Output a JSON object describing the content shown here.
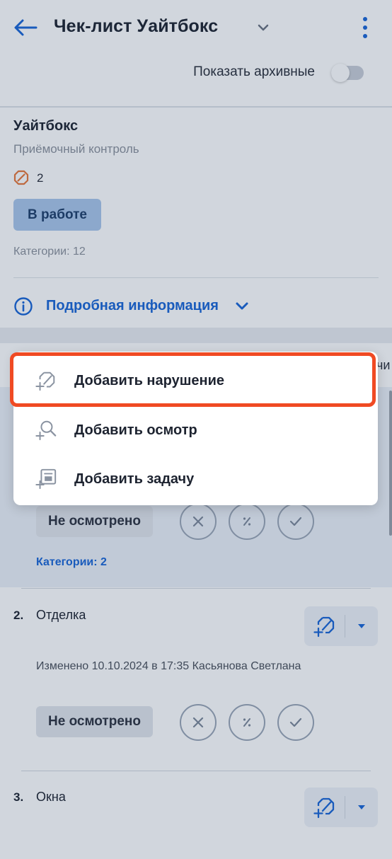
{
  "header": {
    "title": "Чек-лист Уайтбокс",
    "back_icon": "arrow-left-icon",
    "more_icon": "kebab-vertical-icon"
  },
  "archive": {
    "label": "Показать архивные",
    "enabled": false
  },
  "summary": {
    "object_name": "Уайтбокс",
    "control_type": "Приёмочный контроль",
    "violations_count": "2",
    "status": "В работе",
    "categories": "Категории: 12",
    "details_link": "Подробная информация"
  },
  "peek_text": "чи",
  "item1": {
    "status": "Не осмотрено",
    "categories": "Категории: 2"
  },
  "item2": {
    "number": "2.",
    "name": "Отделка",
    "changed": "Изменено 10.10.2024 в 17:35 Касьянова Светлана",
    "status": "Не осмотрено"
  },
  "item3": {
    "number": "3.",
    "name": "Окна"
  },
  "menu": {
    "items": [
      {
        "label": "Добавить нарушение",
        "icon": "add-violation-icon"
      },
      {
        "label": "Добавить осмотр",
        "icon": "add-inspection-icon"
      },
      {
        "label": "Добавить задачу",
        "icon": "add-task-icon"
      }
    ]
  },
  "colors": {
    "accent": "#1a66d6",
    "status_badge": "#a9c6ea",
    "violation": "#e8773a",
    "highlight": "#f04a23"
  }
}
